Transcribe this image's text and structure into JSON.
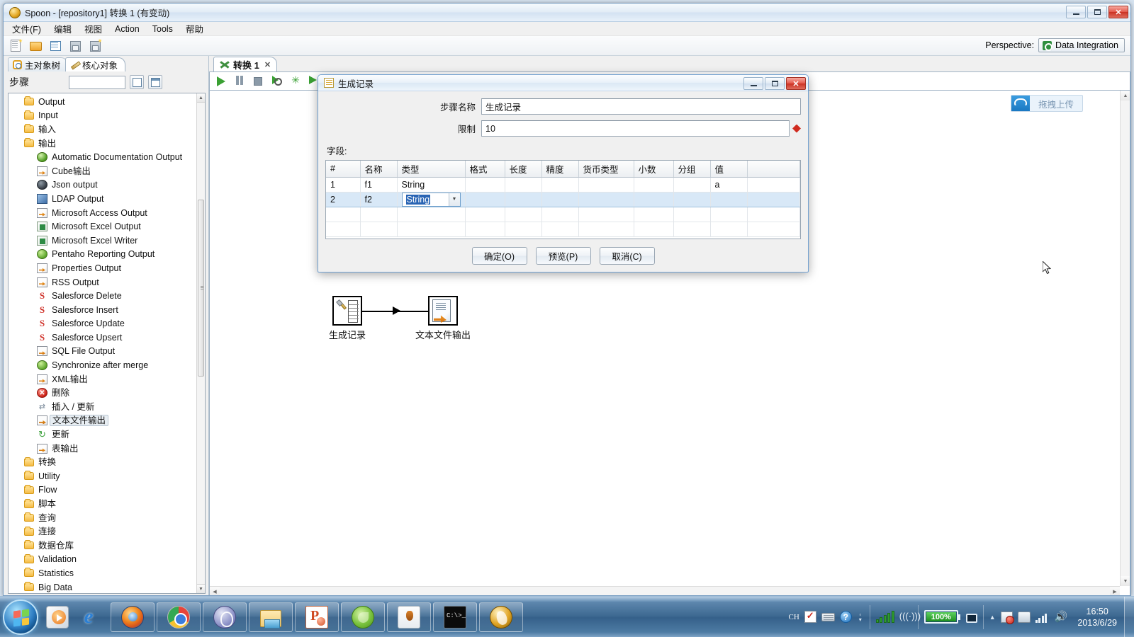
{
  "window": {
    "title": "Spoon - [repository1] 转换 1 (有变动)",
    "app_icon": "spoon-icon",
    "minimize": "minimize-icon",
    "maximize": "maximize-icon",
    "close": "close-icon"
  },
  "menu": [
    "文件(F)",
    "编辑",
    "视图",
    "Action",
    "Tools",
    "帮助"
  ],
  "toolbar": {
    "icons": [
      "new-file-icon",
      "open-folder-icon",
      "explore-repository-icon",
      "save-icon",
      "save-as-icon"
    ],
    "perspective_label": "Perspective:",
    "perspective_value": "Data Integration"
  },
  "left_panel": {
    "tabs": [
      {
        "label": "主对象树",
        "icon": "view-tree-icon",
        "active": false
      },
      {
        "label": "核心对象",
        "icon": "pencil-icon",
        "active": true
      }
    ],
    "steps_label": "步骤",
    "search_value": "",
    "search_placeholder": "",
    "header_buttons": [
      "expand-all-icon",
      "collapse-all-icon"
    ],
    "tree": [
      {
        "label": "Output",
        "type": "folder",
        "icon": "folder-icon"
      },
      {
        "label": "Input",
        "type": "folder",
        "icon": "folder-icon"
      },
      {
        "label": "输入",
        "type": "folder",
        "icon": "folder-icon"
      },
      {
        "label": "输出",
        "type": "folder",
        "icon": "folder-icon"
      },
      {
        "label": "Automatic Documentation Output",
        "type": "step",
        "icon": "green-ball-icon"
      },
      {
        "label": "Cube输出",
        "type": "step",
        "icon": "file-output-icon"
      },
      {
        "label": "Json output",
        "type": "step",
        "icon": "dark-ball-icon"
      },
      {
        "label": "LDAP Output",
        "type": "step",
        "icon": "blue-doc-icon"
      },
      {
        "label": "Microsoft Access Output",
        "type": "step",
        "icon": "file-output-icon"
      },
      {
        "label": "Microsoft Excel Output",
        "type": "step",
        "icon": "excel-icon"
      },
      {
        "label": "Microsoft Excel Writer",
        "type": "step",
        "icon": "excel-writer-icon"
      },
      {
        "label": "Pentaho Reporting Output",
        "type": "step",
        "icon": "green-circle-icon"
      },
      {
        "label": "Properties Output",
        "type": "step",
        "icon": "file-output-icon"
      },
      {
        "label": "RSS Output",
        "type": "step",
        "icon": "rss-icon"
      },
      {
        "label": "Salesforce Delete",
        "type": "step",
        "icon": "salesforce-delete-icon"
      },
      {
        "label": "Salesforce Insert",
        "type": "step",
        "icon": "salesforce-insert-icon"
      },
      {
        "label": "Salesforce Update",
        "type": "step",
        "icon": "salesforce-update-icon"
      },
      {
        "label": "Salesforce Upsert",
        "type": "step",
        "icon": "salesforce-upsert-icon"
      },
      {
        "label": "SQL File Output",
        "type": "step",
        "icon": "file-output-icon"
      },
      {
        "label": "Synchronize after merge",
        "type": "step",
        "icon": "sync-icon"
      },
      {
        "label": "XML输出",
        "type": "step",
        "icon": "file-output-icon"
      },
      {
        "label": "删除",
        "type": "step",
        "icon": "delete-icon"
      },
      {
        "label": "插入 / 更新",
        "type": "step",
        "icon": "insert-update-icon"
      },
      {
        "label": "文本文件输出",
        "type": "step",
        "icon": "text-file-output-icon",
        "selected": true
      },
      {
        "label": "更新",
        "type": "step",
        "icon": "update-icon"
      },
      {
        "label": "表输出",
        "type": "step",
        "icon": "table-output-icon"
      },
      {
        "label": "转换",
        "type": "folder",
        "icon": "folder-icon"
      },
      {
        "label": "Utility",
        "type": "folder",
        "icon": "folder-icon"
      },
      {
        "label": "Flow",
        "type": "folder",
        "icon": "folder-icon"
      },
      {
        "label": "脚本",
        "type": "folder",
        "icon": "folder-icon"
      },
      {
        "label": "查询",
        "type": "folder",
        "icon": "folder-icon"
      },
      {
        "label": "连接",
        "type": "folder",
        "icon": "folder-icon"
      },
      {
        "label": "数据仓库",
        "type": "folder",
        "icon": "folder-icon"
      },
      {
        "label": "Validation",
        "type": "folder",
        "icon": "folder-icon"
      },
      {
        "label": "Statistics",
        "type": "folder",
        "icon": "folder-icon"
      },
      {
        "label": "Big Data",
        "type": "folder",
        "icon": "folder-icon"
      }
    ]
  },
  "canvas": {
    "tab_label": "转换 1",
    "tab_icon": "transformation-icon",
    "tab_close": "✕",
    "toolbar_icons": [
      "run-icon",
      "pause-icon",
      "stop-icon",
      "preview-icon",
      "debug-icon",
      "replay-icon"
    ],
    "upload": {
      "label": "拖拽上传",
      "icon": "cloud-upload-icon"
    },
    "steps": [
      {
        "name": "生成记录",
        "icon": "generate-rows-icon"
      },
      {
        "name": "文本文件输出",
        "icon": "text-file-output-icon"
      }
    ]
  },
  "dialog": {
    "title": "生成记录",
    "icon": "generate-rows-icon",
    "minimize": "minimize-icon",
    "maximize": "maximize-icon",
    "close": "close-icon",
    "step_name_label": "步骤名称",
    "step_name_value": "生成记录",
    "limit_label": "限制",
    "limit_value": "10",
    "variable_icon": "variable-diamond-icon",
    "fields_label": "字段:",
    "columns": [
      "#",
      "名称",
      "类型",
      "格式",
      "长度",
      "精度",
      "货币类型",
      "小数",
      "分组",
      "值"
    ],
    "rows": [
      {
        "num": "1",
        "name": "f1",
        "type": "String",
        "format": "",
        "length": "",
        "precision": "",
        "currency": "",
        "decimal": "",
        "group": "",
        "value": "a",
        "selected": false,
        "editing": false
      },
      {
        "num": "2",
        "name": "f2",
        "type": "String",
        "format": "",
        "length": "",
        "precision": "",
        "currency": "",
        "decimal": "",
        "group": "",
        "value": "",
        "selected": true,
        "editing": true
      }
    ],
    "empty_rows": 2,
    "buttons": [
      {
        "label": "确定(O)",
        "name": "ok-button"
      },
      {
        "label": "预览(P)",
        "name": "preview-button"
      },
      {
        "label": "取消(C)",
        "name": "cancel-button"
      }
    ]
  },
  "taskbar": {
    "start_icon": "windows-start-icon",
    "quick_launch": [
      {
        "name": "windows-media-player-icon"
      },
      {
        "name": "internet-explorer-icon"
      }
    ],
    "tasks": [
      {
        "name": "firefox-icon"
      },
      {
        "name": "chrome-icon"
      },
      {
        "name": "spoon-alt-icon"
      },
      {
        "name": "windows-explorer-icon"
      },
      {
        "name": "powerpoint-icon"
      },
      {
        "name": "pentaho-icon"
      },
      {
        "name": "java-icon"
      },
      {
        "name": "command-prompt-icon"
      },
      {
        "name": "spoon-icon"
      }
    ],
    "tray": {
      "ime": "CH",
      "icons": [
        "ime-pen-icon",
        "keyboard-icon",
        "help-icon",
        "more-icon",
        "signal-icon",
        "wireless-icon"
      ],
      "battery": "100%",
      "battery_icon": "battery-icon",
      "power_icon": "power-plug-icon",
      "overflow_icon": "show-hidden-icons-icon",
      "status_icons": [
        "action-center-flag-icon",
        "network-icon",
        "signal-bars-icon",
        "volume-icon"
      ]
    },
    "clock": {
      "time": "16:50",
      "date": "2013/6/29"
    },
    "show_desktop": "show-desktop-button"
  }
}
